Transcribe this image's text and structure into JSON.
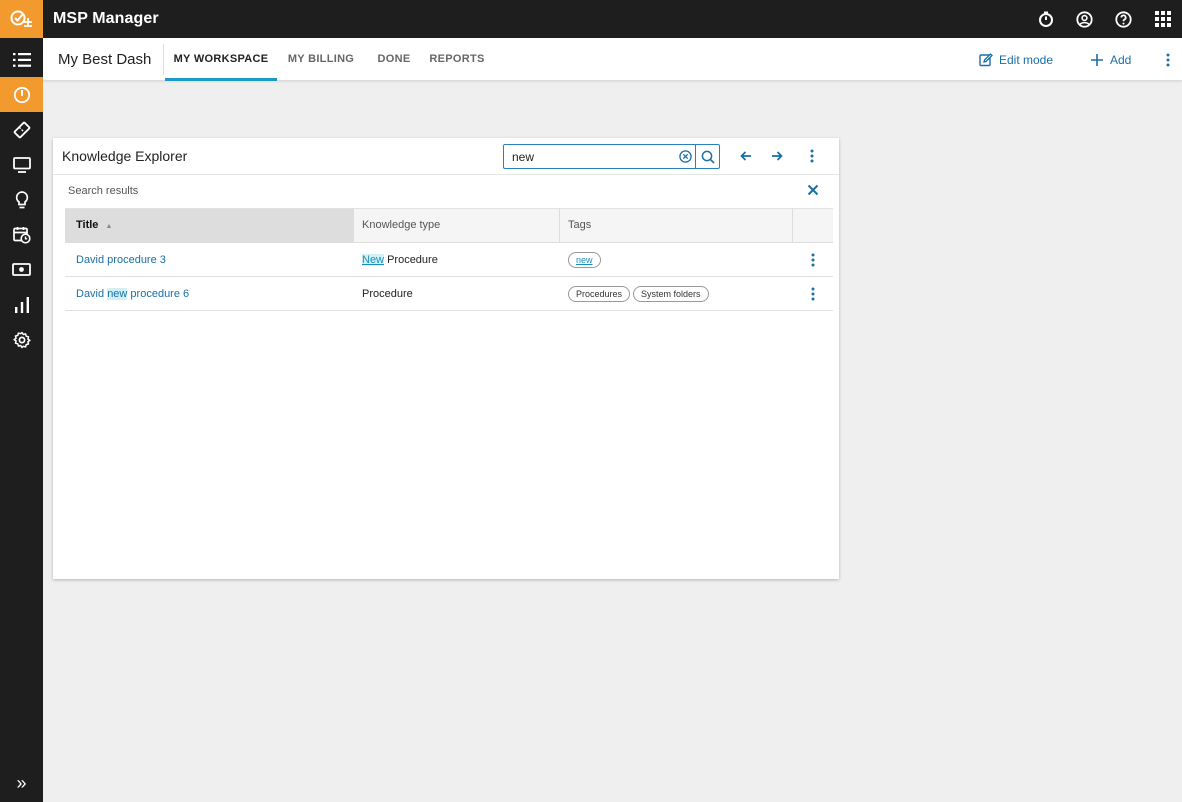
{
  "app": {
    "title": "MSP Manager",
    "accent_color": "#f29a2e",
    "link_color": "#1a6fa5",
    "tab_indicator_color": "#1c9bc6"
  },
  "topbar": {
    "icons": [
      "stopwatch-icon",
      "user-circle-icon",
      "help-icon",
      "apps-grid-icon"
    ]
  },
  "sidebar": {
    "items": [
      {
        "icon": "list-icon",
        "active": false
      },
      {
        "icon": "dashboard-icon",
        "active": true
      },
      {
        "icon": "ticket-icon",
        "active": false
      },
      {
        "icon": "monitor-icon",
        "active": false
      },
      {
        "icon": "lightbulb-icon",
        "active": false
      },
      {
        "icon": "calendar-clock-icon",
        "active": false
      },
      {
        "icon": "money-icon",
        "active": false
      },
      {
        "icon": "bar-chart-icon",
        "active": false
      },
      {
        "icon": "gear-icon",
        "active": false
      }
    ],
    "expand_label": "»"
  },
  "nav": {
    "dashboard_title": "My Best Dash",
    "tabs": [
      {
        "label": "MY WORKSPACE",
        "active": true
      },
      {
        "label": "MY BILLING",
        "active": false
      },
      {
        "label": "DONE",
        "active": false
      },
      {
        "label": "REPORTS",
        "active": false
      }
    ],
    "edit_mode_label": "Edit mode",
    "add_label": "Add"
  },
  "widget": {
    "title": "Knowledge Explorer",
    "search_value": "new",
    "results_label": "Search results",
    "columns": [
      "Title",
      "Knowledge type",
      "Tags",
      ""
    ],
    "rows": [
      {
        "title_before": "David procedure 3",
        "title_match": "",
        "title_after": "",
        "type_match": "New",
        "type_rest": " Procedure",
        "tags": [
          {
            "label": "new",
            "match": true
          }
        ]
      },
      {
        "title_before": "David ",
        "title_match": "new",
        "title_after": " procedure 6",
        "type_match": "",
        "type_rest": "Procedure",
        "tags": [
          {
            "label": "Procedures",
            "match": false
          },
          {
            "label": "System folders",
            "match": false
          }
        ]
      }
    ]
  }
}
